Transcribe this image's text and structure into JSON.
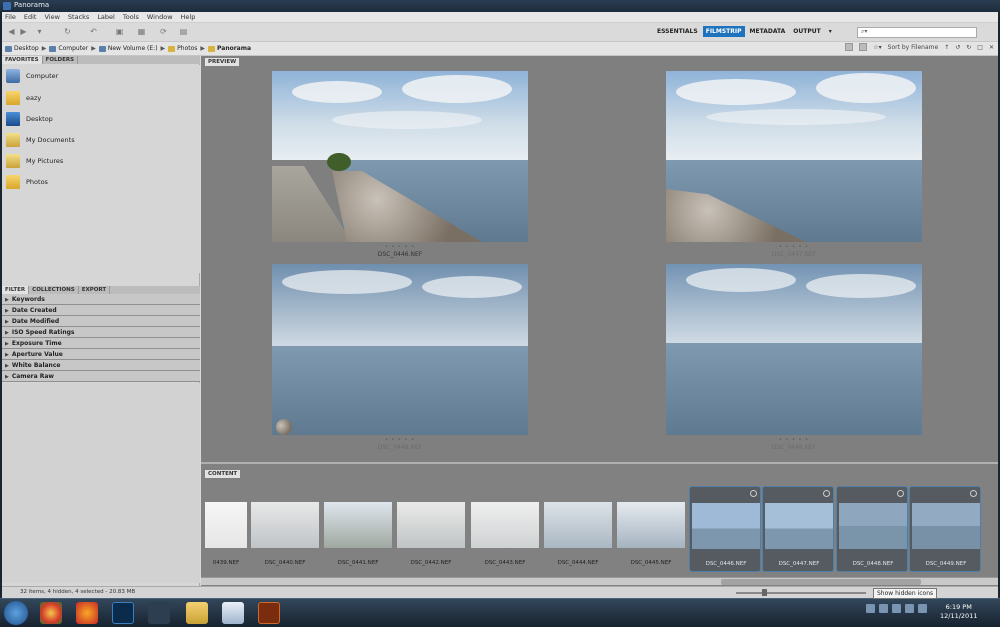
{
  "window": {
    "title": "Panorama"
  },
  "menu": [
    "File",
    "Edit",
    "View",
    "Stacks",
    "Label",
    "Tools",
    "Window",
    "Help"
  ],
  "workspaces": [
    {
      "label": "ESSENTIALS",
      "active": false
    },
    {
      "label": "FILMSTRIP",
      "active": true
    },
    {
      "label": "METADATA",
      "active": false
    },
    {
      "label": "OUTPUT",
      "active": false
    }
  ],
  "search": {
    "placeholder": "⌕▾"
  },
  "path": {
    "crumbs": [
      "Desktop",
      "Computer",
      "New Volume (E:)",
      "Photos",
      "Panorama"
    ]
  },
  "sort": {
    "label": "Sort by Filename"
  },
  "left_panel": {
    "tabs": [
      "FAVORITES",
      "FOLDERS"
    ],
    "favorites": [
      "Computer",
      "eazy",
      "Desktop",
      "My Documents",
      "My Pictures",
      "Photos"
    ],
    "filter_tabs": [
      "FILTER",
      "COLLECTIONS",
      "EXPORT"
    ],
    "filters": [
      "Keywords",
      "Date Created",
      "Date Modified",
      "ISO Speed Ratings",
      "Exposure Time",
      "Aperture Value",
      "White Balance",
      "Camera Raw"
    ]
  },
  "preview": {
    "tab": "PREVIEW",
    "images": [
      {
        "name": "DSC_0446.NEF"
      },
      {
        "name": "DSC_0447.NEF"
      },
      {
        "name": "DSC_0448.NEF"
      },
      {
        "name": "DSC_0449.NEF"
      }
    ],
    "stars": "• • • • •"
  },
  "content": {
    "tab": "CONTENT",
    "thumbs": [
      {
        "name": "0439.NEF",
        "selected": false
      },
      {
        "name": "DSC_0440.NEF",
        "selected": false
      },
      {
        "name": "DSC_0441.NEF",
        "selected": false
      },
      {
        "name": "DSC_0442.NEF",
        "selected": false
      },
      {
        "name": "DSC_0443.NEF",
        "selected": false
      },
      {
        "name": "DSC_0444.NEF",
        "selected": false
      },
      {
        "name": "DSC_0445.NEF",
        "selected": false
      },
      {
        "name": "DSC_0446.NEF",
        "selected": true
      },
      {
        "name": "DSC_0447.NEF",
        "selected": true
      },
      {
        "name": "DSC_0448.NEF",
        "selected": true
      },
      {
        "name": "DSC_0449.NEF",
        "selected": true
      }
    ]
  },
  "status": {
    "text": "32 items, 4 hidden, 4 selected - 20.83 MB"
  },
  "taskbar": {
    "tooltip": "Show hidden icons",
    "time": "6:19 PM",
    "date": "12/11/2011"
  },
  "colors": {
    "accent": "#1e73be",
    "selection_border": "#4f7fa8"
  }
}
